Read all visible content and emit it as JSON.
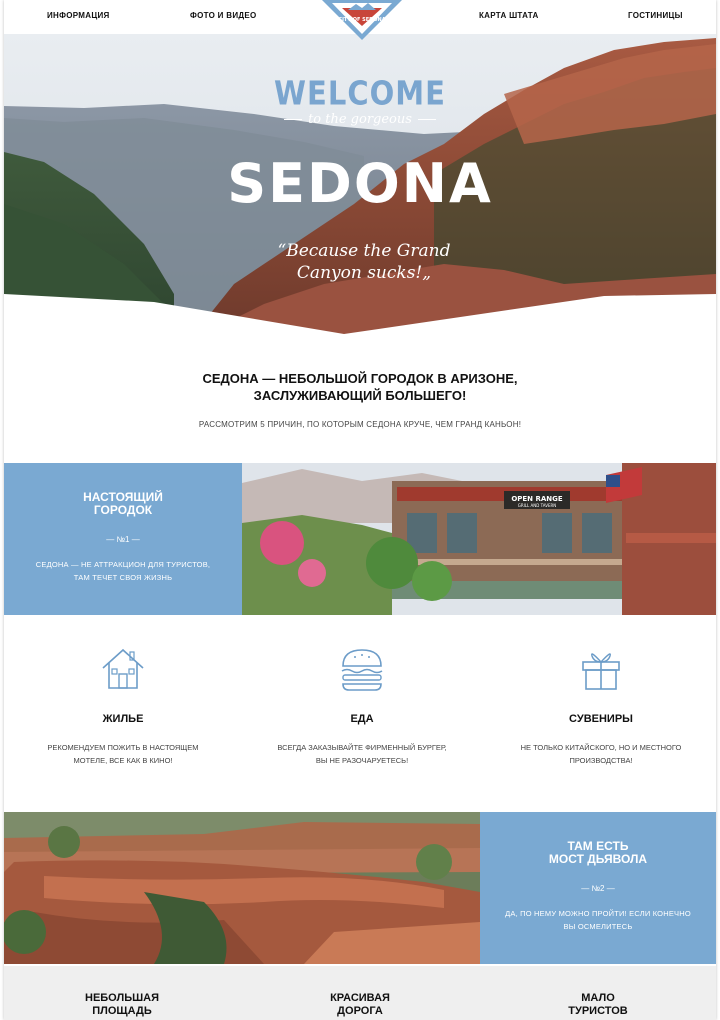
{
  "nav": {
    "items": [
      "ИНФОРМАЦИЯ",
      "ФОТО И ВИДЕО",
      "КАРТА ШТАТА",
      "ГОСТИНИЦЫ"
    ],
    "logo_text": "CITY OF SEDONA"
  },
  "hero": {
    "welcome": "WELCOME",
    "subtitle": "to the gorgeous",
    "title": "SEDONA",
    "quote_line1": "“Because the Grand",
    "quote_line2": "Canyon sucks!„"
  },
  "intro": {
    "title_line1": "СЕДОНА — НЕБОЛЬШОЙ ГОРОДОК В АРИЗОНЕ,",
    "title_line2": "ЗАСЛУЖИВАЮЩИЙ БОЛЬШЕГО!",
    "subtitle": "РАССМОТРИМ 5 ПРИЧИН, ПО КОТОРЫМ СЕДОНА КРУЧЕ, ЧЕМ ГРАНД КАНЬОН!"
  },
  "reason1": {
    "title_line1": "НАСТОЯЩИЙ",
    "title_line2": "ГОРОДОК",
    "number": "— №1 —",
    "text_line1": "СЕДОНА — НЕ АТТРАКЦИОН ДЛЯ ТУРИСТОВ,",
    "text_line2": "ТАМ ТЕЧЕТ СВОЯ ЖИЗНЬ",
    "sign_text": "OPEN RANGE",
    "sign_sub": "GRILL AND TAVERN"
  },
  "features": [
    {
      "icon": "house-icon",
      "title": "ЖИЛЬЕ",
      "text_line1": "РЕКОМЕНДУЕМ ПОЖИТЬ В НАСТОЯЩЕМ",
      "text_line2": "МОТЕЛЕ, ВСЕ КАК В КИНО!"
    },
    {
      "icon": "burger-icon",
      "title": "ЕДА",
      "text_line1": "ВСЕГДА ЗАКАЗЫВАЙТЕ ФИРМЕННЫЙ БУРГЕР,",
      "text_line2": "ВЫ НЕ РАЗОЧАРУЕТЕСЬ!"
    },
    {
      "icon": "gift-icon",
      "title": "СУВЕНИРЫ",
      "text_line1": "НЕ ТОЛЬКО КИТАЙСКОГО, НО И МЕСТНОГО",
      "text_line2": "ПРОИЗВОДСТВА!"
    }
  ],
  "reason2": {
    "title_line1": "ТАМ ЕСТЬ",
    "title_line2": "МОСТ ДЬЯВОЛА",
    "number": "— №2 —",
    "text_line1": "ДА, ПО НЕМУ МОЖНО ПРОЙТИ! ЕСЛИ КОНЕЧНО",
    "text_line2": "ВЫ ОСМЕЛИТЕСЬ"
  },
  "bottom": [
    {
      "line1": "НЕБОЛЬШАЯ",
      "line2": "ПЛОЩАДЬ"
    },
    {
      "line1": "КРАСИВАЯ",
      "line2": "ДОРОГА"
    },
    {
      "line1": "МАЛО",
      "line2": "ТУРИСТОВ"
    }
  ],
  "colors": {
    "accent": "#7aa9d2",
    "logo_red": "#c8453a"
  }
}
